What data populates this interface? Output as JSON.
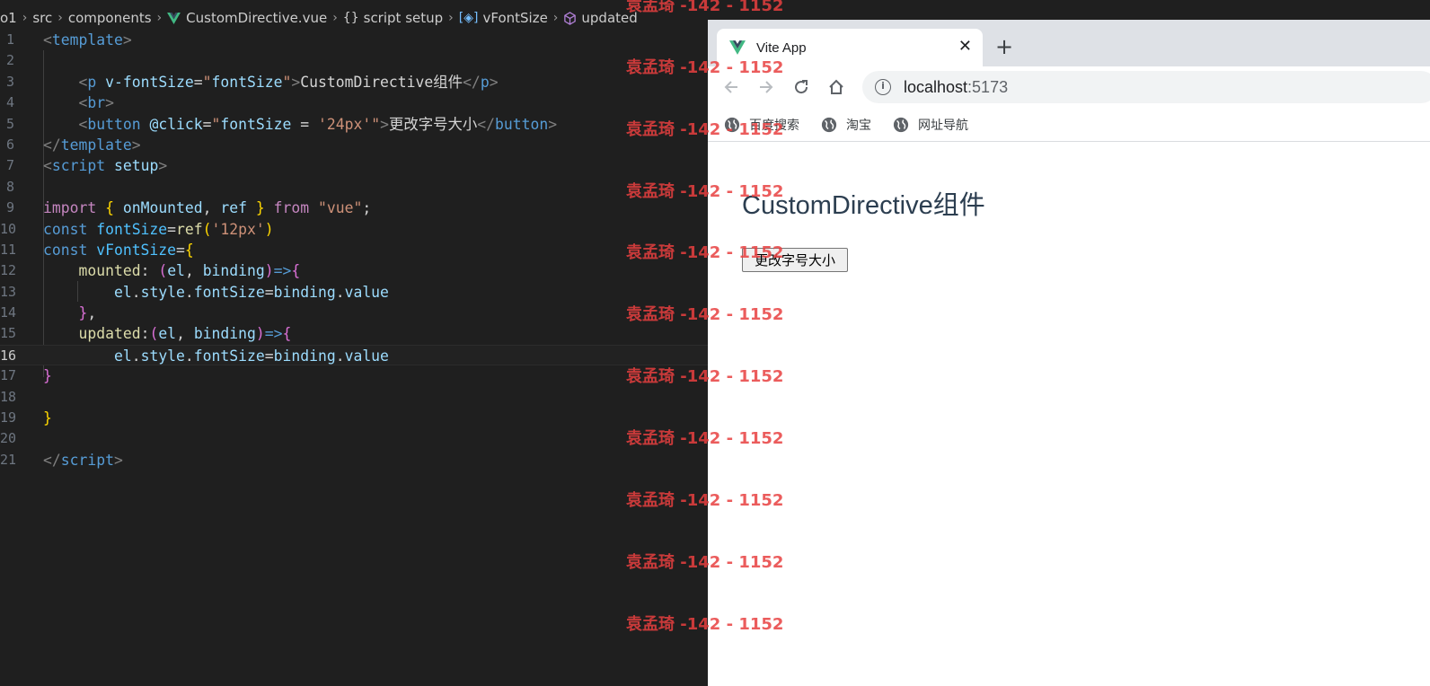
{
  "breadcrumb": {
    "items": [
      "o1",
      "src",
      "components",
      "CustomDirective.vue",
      "script setup",
      "vFontSize",
      "updated"
    ]
  },
  "editor": {
    "line_numbers": [
      "1",
      "2",
      "3",
      "4",
      "5",
      "6",
      "7",
      "8",
      "9",
      "10",
      "11",
      "12",
      "13",
      "14",
      "15",
      "16",
      "17",
      "18",
      "19",
      "20",
      "21"
    ],
    "active_line": "16",
    "lines": [
      [
        {
          "t": "<",
          "c": "t-br"
        },
        {
          "t": "template",
          "c": "t-tag"
        },
        {
          "t": ">",
          "c": "t-br"
        }
      ],
      [],
      [
        {
          "t": "    "
        },
        {
          "t": "<",
          "c": "t-br"
        },
        {
          "t": "p",
          "c": "t-tag"
        },
        {
          "t": " "
        },
        {
          "t": "v-fontSize",
          "c": "t-attr"
        },
        {
          "t": "=",
          "c": "t-txt"
        },
        {
          "t": "\"",
          "c": "t-str"
        },
        {
          "t": "fontSize",
          "c": "t-var"
        },
        {
          "t": "\"",
          "c": "t-str"
        },
        {
          "t": ">",
          "c": "t-br"
        },
        {
          "t": "CustomDirective组件",
          "c": "t-txt"
        },
        {
          "t": "</",
          "c": "t-br"
        },
        {
          "t": "p",
          "c": "t-tag"
        },
        {
          "t": ">",
          "c": "t-br"
        }
      ],
      [
        {
          "t": "    "
        },
        {
          "t": "<",
          "c": "t-br"
        },
        {
          "t": "br",
          "c": "t-tag"
        },
        {
          "t": ">",
          "c": "t-br"
        }
      ],
      [
        {
          "t": "    "
        },
        {
          "t": "<",
          "c": "t-br"
        },
        {
          "t": "button",
          "c": "t-tag"
        },
        {
          "t": " "
        },
        {
          "t": "@click",
          "c": "t-attr"
        },
        {
          "t": "=",
          "c": "t-txt"
        },
        {
          "t": "\"",
          "c": "t-str"
        },
        {
          "t": "fontSize",
          "c": "t-var"
        },
        {
          "t": " = ",
          "c": "t-txt"
        },
        {
          "t": "'24px'",
          "c": "t-str"
        },
        {
          "t": "\"",
          "c": "t-str"
        },
        {
          "t": ">",
          "c": "t-br"
        },
        {
          "t": "更改字号大小",
          "c": "t-txt"
        },
        {
          "t": "</",
          "c": "t-br"
        },
        {
          "t": "button",
          "c": "t-tag"
        },
        {
          "t": ">",
          "c": "t-br"
        }
      ],
      [
        {
          "t": "</",
          "c": "t-br"
        },
        {
          "t": "template",
          "c": "t-tag"
        },
        {
          "t": ">",
          "c": "t-br"
        }
      ],
      [
        {
          "t": "<",
          "c": "t-br"
        },
        {
          "t": "script",
          "c": "t-tag"
        },
        {
          "t": " "
        },
        {
          "t": "setup",
          "c": "t-attr"
        },
        {
          "t": ">",
          "c": "t-br"
        }
      ],
      [],
      [
        {
          "t": "import",
          "c": "t-kw"
        },
        {
          "t": " "
        },
        {
          "t": "{",
          "c": "t-p1"
        },
        {
          "t": " "
        },
        {
          "t": "onMounted",
          "c": "t-var"
        },
        {
          "t": ", ",
          "c": "t-txt"
        },
        {
          "t": "ref",
          "c": "t-var"
        },
        {
          "t": " "
        },
        {
          "t": "}",
          "c": "t-p1"
        },
        {
          "t": " "
        },
        {
          "t": "from",
          "c": "t-kw"
        },
        {
          "t": " "
        },
        {
          "t": "\"vue\"",
          "c": "t-str"
        },
        {
          "t": ";",
          "c": "t-txt"
        }
      ],
      [
        {
          "t": "const",
          "c": "t-decl"
        },
        {
          "t": " "
        },
        {
          "t": "fontSize",
          "c": "t-const"
        },
        {
          "t": "=",
          "c": "t-txt"
        },
        {
          "t": "ref",
          "c": "t-fn"
        },
        {
          "t": "(",
          "c": "t-p1"
        },
        {
          "t": "'12px'",
          "c": "t-str"
        },
        {
          "t": ")",
          "c": "t-p1"
        }
      ],
      [
        {
          "t": "const",
          "c": "t-decl"
        },
        {
          "t": " "
        },
        {
          "t": "vFontSize",
          "c": "t-const"
        },
        {
          "t": "=",
          "c": "t-txt"
        },
        {
          "t": "{",
          "c": "t-p1"
        }
      ],
      [
        {
          "t": "    "
        },
        {
          "t": "mounted",
          "c": "t-fn"
        },
        {
          "t": ": ",
          "c": "t-txt"
        },
        {
          "t": "(",
          "c": "t-p2"
        },
        {
          "t": "el",
          "c": "t-var"
        },
        {
          "t": ", ",
          "c": "t-txt"
        },
        {
          "t": "binding",
          "c": "t-var"
        },
        {
          "t": ")",
          "c": "t-p2"
        },
        {
          "t": "=>",
          "c": "t-decl"
        },
        {
          "t": "{",
          "c": "t-p2"
        }
      ],
      [
        {
          "t": "        "
        },
        {
          "t": "el",
          "c": "t-var"
        },
        {
          "t": ".",
          "c": "t-txt"
        },
        {
          "t": "style",
          "c": "t-var"
        },
        {
          "t": ".",
          "c": "t-txt"
        },
        {
          "t": "fontSize",
          "c": "t-var"
        },
        {
          "t": "=",
          "c": "t-txt"
        },
        {
          "t": "binding",
          "c": "t-var"
        },
        {
          "t": ".",
          "c": "t-txt"
        },
        {
          "t": "value",
          "c": "t-var"
        }
      ],
      [
        {
          "t": "    "
        },
        {
          "t": "}",
          "c": "t-p2"
        },
        {
          "t": ",",
          "c": "t-txt"
        }
      ],
      [
        {
          "t": "    "
        },
        {
          "t": "updated",
          "c": "t-fn"
        },
        {
          "t": ":",
          "c": "t-txt"
        },
        {
          "t": "(",
          "c": "t-p2"
        },
        {
          "t": "el",
          "c": "t-var"
        },
        {
          "t": ", ",
          "c": "t-txt"
        },
        {
          "t": "binding",
          "c": "t-var"
        },
        {
          "t": ")",
          "c": "t-p2"
        },
        {
          "t": "=>",
          "c": "t-decl"
        },
        {
          "t": "{",
          "c": "t-p2"
        }
      ],
      [
        {
          "t": "        "
        },
        {
          "t": "el",
          "c": "t-var"
        },
        {
          "t": ".",
          "c": "t-txt"
        },
        {
          "t": "style",
          "c": "t-var"
        },
        {
          "t": ".",
          "c": "t-txt"
        },
        {
          "t": "fontSize",
          "c": "t-var"
        },
        {
          "t": "=",
          "c": "t-txt"
        },
        {
          "t": "binding",
          "c": "t-var"
        },
        {
          "t": ".",
          "c": "t-txt"
        },
        {
          "t": "value",
          "c": "t-var"
        }
      ],
      [
        {
          "t": "}",
          "c": "t-p2"
        }
      ],
      [],
      [
        {
          "t": "}",
          "c": "t-p1"
        }
      ],
      [],
      [
        {
          "t": "</",
          "c": "t-br"
        },
        {
          "t": "script",
          "c": "t-tag"
        },
        {
          "t": ">",
          "c": "t-br"
        }
      ]
    ]
  },
  "browser": {
    "tab_title": "Vite App",
    "tab_close": "✕",
    "new_tab": "+",
    "url_host": "localhost",
    "url_port": ":5173",
    "bookmarks": [
      "百度搜索",
      "淘宝",
      "网址导航"
    ]
  },
  "page": {
    "heading": "CustomDirective组件",
    "button_label": "更改字号大小"
  },
  "watermark": {
    "text": "袁孟琦 -142 - 1152"
  },
  "icons": {
    "vue": "vue-logo-icon",
    "back": "arrow-left-icon",
    "forward": "arrow-right-icon",
    "reload": "reload-icon",
    "home": "home-icon",
    "info": "info-icon",
    "globe": "globe-icon"
  }
}
